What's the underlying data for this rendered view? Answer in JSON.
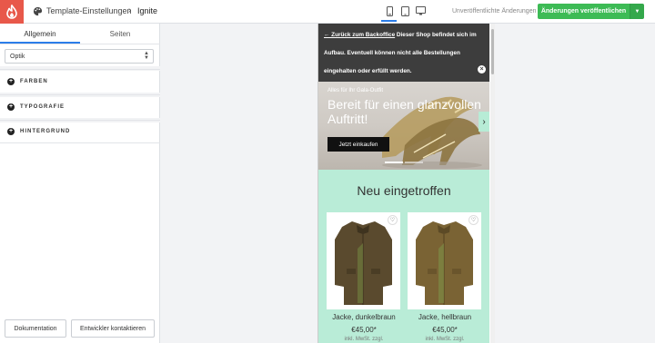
{
  "header": {
    "breadcrumb": "Template-Einstellungen",
    "template_name": "Ignite",
    "unpublished_label": "Unveröffentlichte Änderungen",
    "publish_label": "Änderungen veröffentlichen",
    "accent_color": "#3dbb55",
    "logo_color": "#e8584a",
    "devices": [
      "mobile-icon",
      "tablet-icon",
      "desktop-icon"
    ],
    "active_device": "mobile"
  },
  "sidebar": {
    "tabs": [
      {
        "label": "Allgemein",
        "active": true
      },
      {
        "label": "Seiten",
        "active": false
      }
    ],
    "select_value": "Optik",
    "sections": [
      {
        "label": "FARBEN"
      },
      {
        "label": "TYPOGRAFIE"
      },
      {
        "label": "HINTERGRUND"
      }
    ],
    "buttons": {
      "documentation": "Dokumentation",
      "contact": "Entwickler kontaktieren"
    }
  },
  "preview": {
    "notice": {
      "back_link": "← Zurück zum Backoffice",
      "text": " Dieser Shop befindet sich im Aufbau. Eventuell können nicht alle Bestellungen eingehalten oder erfüllt werden."
    },
    "hero": {
      "subtitle": "Alles für Ihr Gala-Outfit",
      "title": "Bereit für einen glanzvollen Auftritt!",
      "button": "Jetzt einkaufen"
    },
    "section_title": "Neu eingetroffen",
    "products": [
      {
        "name": "Jacke, dunkelbraun",
        "price": "€45,00*",
        "badge": "inkl. MwSt. zzgl."
      },
      {
        "name": "Jacke, hellbraun",
        "price": "€45,00*",
        "badge": "inkl. MwSt. zzgl."
      }
    ],
    "mint_color": "#b9ecd7"
  }
}
